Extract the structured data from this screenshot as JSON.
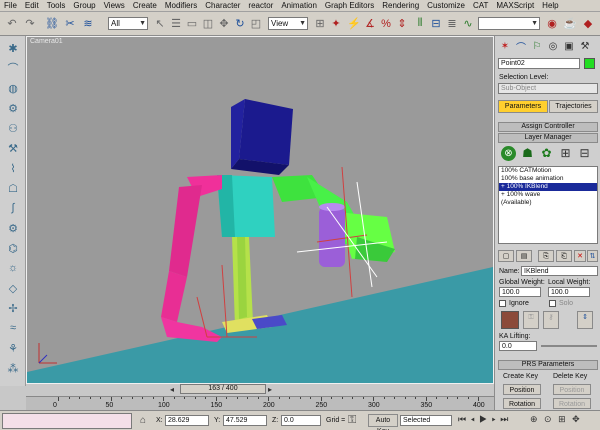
{
  "menu": [
    "File",
    "Edit",
    "Tools",
    "Group",
    "Views",
    "Create",
    "Modifiers",
    "Character",
    "reactor",
    "Animation",
    "Graph Editors",
    "Rendering",
    "Customize",
    "CAT",
    "MAXScript",
    "Help"
  ],
  "toolbar": {
    "filter_value": "All",
    "refcoord_value": "View"
  },
  "viewport": {
    "label": "Camera01"
  },
  "command_panel": {
    "object_name": "Point02",
    "object_color": "#22dd22",
    "selection_level_label": "Selection Level:",
    "sub_object_value": "Sub-Object",
    "tab_parameters": "Parameters",
    "tab_trajectories": "Trajectories",
    "assign_controller": "Assign Controller",
    "layer_manager": "Layer Manager",
    "layers": [
      {
        "text": "100% CATMotion",
        "selected": false
      },
      {
        "text": "100% base animation",
        "selected": false
      },
      {
        "text": "+   100% IKBlend",
        "selected": true
      },
      {
        "text": "+   100% wave",
        "selected": false
      },
      {
        "text": "(Available)",
        "selected": false
      }
    ],
    "name_label": "Name:",
    "name_value": "IKBlend",
    "global_weight_label": "Global Weight:",
    "local_weight_label": "Local Weight:",
    "global_weight_value": "100.0",
    "local_weight_value": "100.0",
    "ignore_label": "Ignore",
    "solo_label": "Solo",
    "ka_lifting_label": "KA Lifting:",
    "ka_lifting_value": "0.0",
    "prs_params": "PRS Parameters",
    "create_key_label": "Create Key",
    "delete_key_label": "Delete Key",
    "position_label": "Position",
    "position_label_2": "Position",
    "rotation_label": "Rotation",
    "rotation_label_2": "Rotation",
    "swatch_color": "#8b4a3a"
  },
  "timeline": {
    "slider_text": "163 / 400",
    "ticks": [
      "0",
      "50",
      "100",
      "150",
      "200",
      "250",
      "300",
      "350",
      "400"
    ]
  },
  "status": {
    "x_label": "X:",
    "x_value": "28.629",
    "y_label": "Y:",
    "y_value": "47.529",
    "z_label": "Z:",
    "z_value": "0.0",
    "grid_label": "Grid =",
    "auto_key": "Auto Key",
    "selected_value": "Selected"
  }
}
